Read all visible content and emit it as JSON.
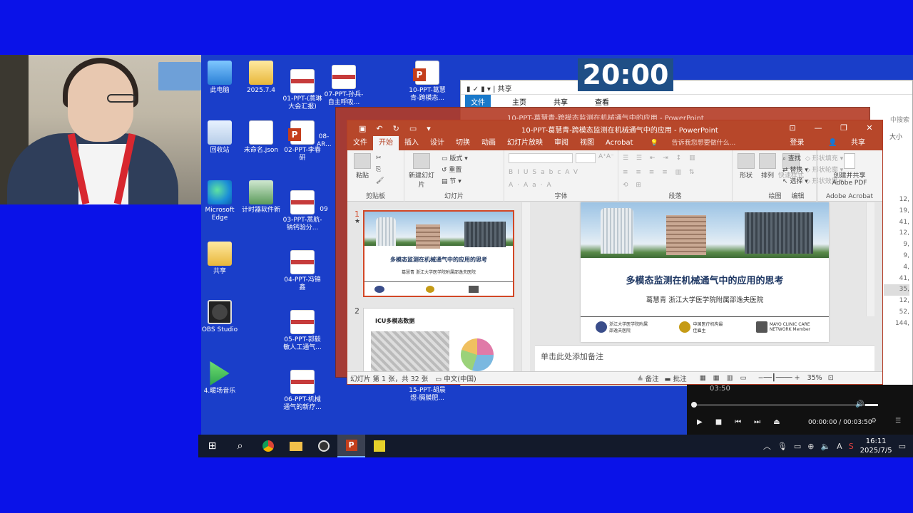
{
  "timer": "20:00",
  "desktop_icons": [
    {
      "label": "此电脑"
    },
    {
      "label": "2025.7.4"
    },
    {
      "label": "01-PPT-(蒿琳大会汇报)"
    },
    {
      "label": "07-PPT-孙兵-自主呼吸..."
    },
    {
      "label": "10-PPT-葛慧青-跨模态..."
    },
    {
      "label": "回收站"
    },
    {
      "label": "未命名.json"
    },
    {
      "label": "02-PPT-李春研"
    },
    {
      "label": "08-AR..."
    },
    {
      "label": "Microsoft Edge"
    },
    {
      "label": "计时器软件新"
    },
    {
      "label": "03-PPT-蒿航-钠钙验分..."
    },
    {
      "label": "09"
    },
    {
      "label": "共享"
    },
    {
      "label": "04-PPT-冯锦鑫"
    },
    {
      "label": "OBS Studio"
    },
    {
      "label": "05-PPT-郭毅敏人工通气..."
    },
    {
      "label": "4.暖场音乐"
    },
    {
      "label": "06-PPT-机械通气的新疗..."
    },
    {
      "label": "15-PPT-胡晨煜-膈膜肥..."
    }
  ],
  "explorer": {
    "path": "共享",
    "tabs": [
      "文件",
      "主页",
      "共享",
      "查看"
    ],
    "column": "大小",
    "search_hint": "中搜索",
    "share_label": "共享",
    "sizes": [
      "12,",
      "19,",
      "41,",
      "12,",
      "9,",
      "9,",
      "4,",
      "41,",
      "35,",
      "12,",
      "52,",
      "144,"
    ]
  },
  "ghost_window": {
    "title": "10-PPT-葛慧青-跨模态监测在机械通气中的应用 - PowerPoint"
  },
  "ppt": {
    "title": "10-PPT-葛慧青-跨模态监测在机械通气中的应用 - PowerPoint",
    "tabs": [
      "文件",
      "开始",
      "插入",
      "设计",
      "切换",
      "动画",
      "幻灯片放映",
      "审阅",
      "视图",
      "Acrobat"
    ],
    "tell_me": "告诉我您想要做什么...",
    "login": "登录",
    "share": "共享",
    "groups": {
      "clipboard": "剪贴板",
      "paste": "粘贴",
      "slides": "幻灯片",
      "new_slide": "新建幻灯片",
      "layout": "版式",
      "reset": "重置",
      "section": "节",
      "font": "字体",
      "paragraph": "段落",
      "drawing": "绘图",
      "shape": "形状",
      "arrange": "排列",
      "quick_style": "快速样式",
      "fill": "形状填充",
      "outline": "形状轮廓",
      "effect": "形状效果",
      "edit": "编辑",
      "find": "查找",
      "replace": "替换",
      "select": "选择",
      "acrobat": "Adobe Acrobat",
      "create_share": "创建并共享",
      "adobe_pdf": "Adobe PDF"
    },
    "slide1": {
      "num": "1",
      "title": "多模态监测在机械通气中的应用的思考",
      "subtitle": "葛慧青 浙江大学医学院附属邵逸夫医院"
    },
    "slide2": {
      "num": "2",
      "title": "ICU多模态数据"
    },
    "logos": [
      "浙江大学医学院附属邵逸夫医院",
      "中国医疗机构最佳雇主",
      "MAYO CLINIC CARE NETWORK Member"
    ],
    "notes_placeholder": "单击此处添加备注",
    "status": {
      "slide_info": "幻灯片 第 1 张，共 32 张",
      "language": "中文(中国)",
      "notes": "备注",
      "comments": "批注",
      "zoom": "35%"
    }
  },
  "player": {
    "elapsed_top": "03:50",
    "current": "00:00:00",
    "total": "00:03:50"
  },
  "taskbar": {
    "time": "16:11",
    "date": "2025/7/5"
  }
}
